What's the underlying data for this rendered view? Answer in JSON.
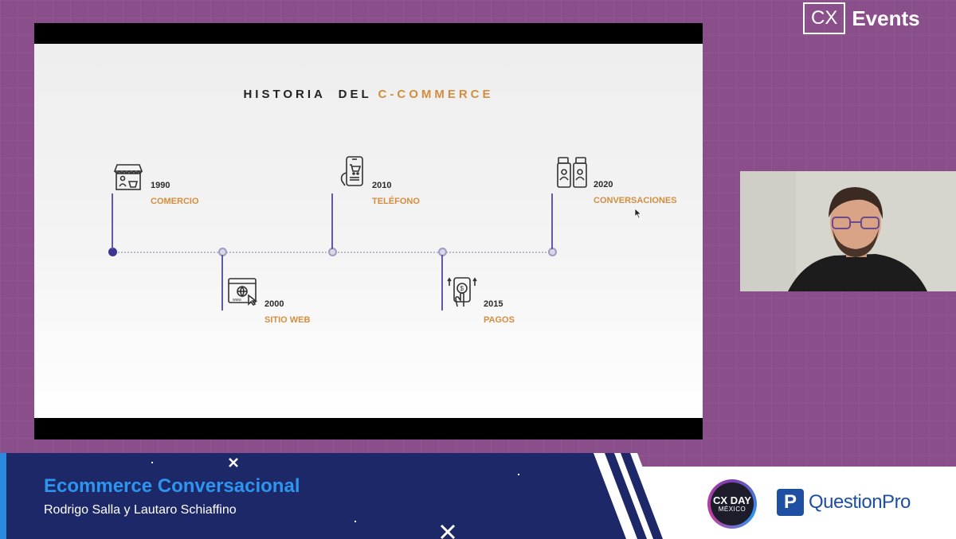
{
  "brand": {
    "box_text": "CX",
    "events_text": "Events"
  },
  "slide": {
    "title_part1": "HISTORIA  DEL ",
    "title_part2": "C-COMMERCE",
    "events": [
      {
        "year": "1990",
        "label": "COMERCIO",
        "icon": "storefront-icon"
      },
      {
        "year": "2000",
        "label": "SITIO WEB",
        "icon": "website-icon"
      },
      {
        "year": "2010",
        "label": "TELÉFONO",
        "icon": "smartphone-cart-icon"
      },
      {
        "year": "2015",
        "label": "PAGOS",
        "icon": "mobile-payment-icon"
      },
      {
        "year": "2020",
        "label": "CONVERSACIONES",
        "icon": "chat-users-icon"
      }
    ]
  },
  "lower_third": {
    "title": "Ecommerce Conversacional",
    "speakers": "Rodrigo Salla y Lautaro Schiaffino"
  },
  "sponsors": {
    "cx_day_top": "CX DAY",
    "cx_day_bottom": "MÉXICO",
    "questionpro_icon": "P",
    "questionpro_text": "QuestionPro"
  },
  "colors": {
    "background": "#8a4f8a",
    "slide_accent": "#d48d3e",
    "timeline_primary": "#3a3590",
    "lower_third_bg": "#1c2868",
    "title_blue": "#2e95ef",
    "questionpro_blue": "#1e4fa3"
  }
}
